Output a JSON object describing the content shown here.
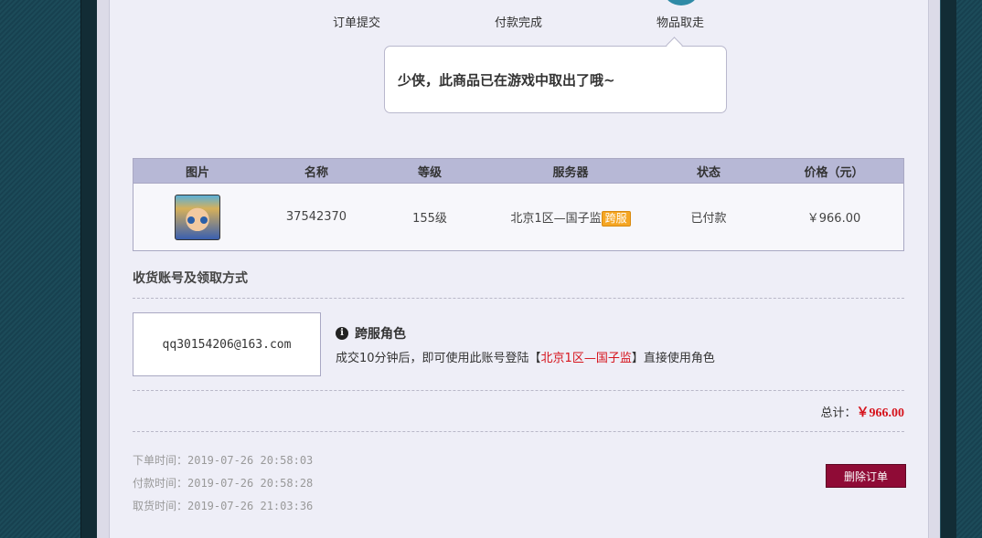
{
  "steps": [
    "订单提交",
    "付款完成",
    "物品取走"
  ],
  "bubble_text": "少侠，此商品已在游戏中取出了哦~",
  "table": {
    "headers": [
      "图片",
      "名称",
      "等级",
      "服务器",
      "状态",
      "价格（元）"
    ],
    "row": {
      "name": "37542370",
      "level": "155级",
      "server": "北京1区—国子监",
      "server_badge": "跨服",
      "status": "已付款",
      "price": "￥966.00"
    }
  },
  "section_title": "收货账号及领取方式",
  "account": "qq30154206@163.com",
  "role": {
    "title": "跨服角色",
    "desc_prefix": "成交10分钟后，即可使用此账号登陆【",
    "desc_server": "北京1区—国子监",
    "desc_suffix": "】直接使用角色"
  },
  "total": {
    "label": "总计：",
    "amount": "￥966.00"
  },
  "times": {
    "order": "下单时间：2019-07-26 20:58:03",
    "paid": "付款时间：2019-07-26 20:58:28",
    "pickup": "取货时间：2019-07-26 21:03:36"
  },
  "delete_button": "删除订单",
  "colors": {
    "accent_red": "#d6141d",
    "button_bg": "#8f0b36",
    "table_header": "#b7b8d6",
    "step_active": "#2f8aa6"
  }
}
